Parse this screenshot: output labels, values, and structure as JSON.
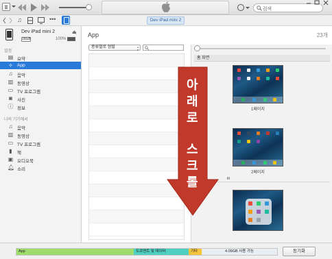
{
  "toolbar": {
    "search_placeholder": "검색",
    "device_pill": "Dev iPad mini 2"
  },
  "device": {
    "name": "Dev iPad mini 2",
    "capacity": "16GB",
    "battery": "100%"
  },
  "sidebar": {
    "settings_header": "설정",
    "settings_items": [
      {
        "label": "요약",
        "icon": "summary-icon"
      },
      {
        "label": "App",
        "icon": "app-store-icon",
        "selected": true
      },
      {
        "label": "음악",
        "icon": "music-icon"
      },
      {
        "label": "동영상",
        "icon": "film-icon"
      },
      {
        "label": "TV 프로그램",
        "icon": "tv-icon"
      },
      {
        "label": "사진",
        "icon": "camera-icon"
      },
      {
        "label": "정보",
        "icon": "info-icon"
      }
    ],
    "ondevice_header": "나의 기기에서",
    "ondevice_items": [
      {
        "label": "음악",
        "icon": "music-icon"
      },
      {
        "label": "동영상",
        "icon": "film-icon"
      },
      {
        "label": "TV 프로그램",
        "icon": "tv-icon"
      },
      {
        "label": "책",
        "icon": "book-icon"
      },
      {
        "label": "오디오북",
        "icon": "audiobook-icon"
      },
      {
        "label": "소리",
        "icon": "bell-icon"
      }
    ]
  },
  "main": {
    "title": "App",
    "count": "23개",
    "sort_value": "종류별로 정렬",
    "home_screen_header": "홈 화면",
    "pages": [
      "1페이지",
      "2페이지"
    ],
    "section_fragment": "ilt"
  },
  "overlay": {
    "lines": [
      "아",
      "래",
      "로",
      "스",
      "크",
      "롤"
    ],
    "color": "#c0392b"
  },
  "storage": {
    "segments": [
      {
        "label": "App",
        "color": "#9fdc6b",
        "fraction": 0.45
      },
      {
        "label": "도큐멘트 및 데이터",
        "color": "#4fcfc0",
        "fraction": 0.21
      },
      {
        "label": "기타",
        "color": "#f5c43c",
        "fraction": 0.05
      },
      {
        "label": "4.09GB 사용 가능",
        "color": "#e9eef5",
        "fraction": 0.29
      }
    ],
    "sync_label": "동기화"
  }
}
